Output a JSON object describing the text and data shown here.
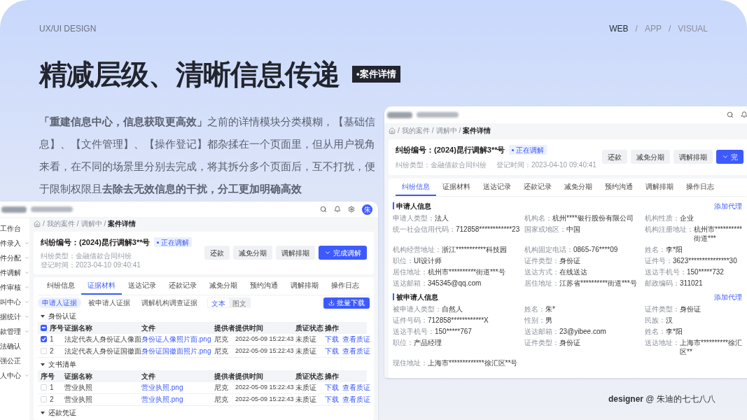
{
  "header": {
    "label": "UX/UI DESIGN",
    "nav": [
      {
        "kind": "link",
        "text": "WEB",
        "selected": true
      },
      {
        "kind": "separator",
        "text": "/"
      },
      {
        "kind": "link",
        "text": "APP",
        "selected": false
      },
      {
        "kind": "separator",
        "text": "/"
      },
      {
        "kind": "link",
        "text": "VISUAL",
        "selected": false
      }
    ]
  },
  "headline": {
    "title": "精减层级、清晰信息传递",
    "badge": "•案件详情"
  },
  "intro": "**「重建信息中心，信息获取更高效」**之前的详情模块分类模糊，【基础信息】、【文件管理】、【操作登记】都杂揉在一个页面里，但从用户视角来看，在不同的场景里分别去完成，将其拆分多个页面后，互不打扰，便于限制权限且**去除去无效信息的干扰，分工更加明确高效**",
  "evidence_screen": {
    "avatar": "朱",
    "sidebar": [
      {
        "label": "工作台",
        "expandable": false
      },
      {
        "label": "件录入",
        "expandable": true
      },
      {
        "label": "件分配",
        "expandable": true
      },
      {
        "label": "件调解",
        "expandable": true
      },
      {
        "label": "件审核",
        "expandable": true
      },
      {
        "label": "叫中心",
        "expandable": true
      },
      {
        "label": "据统计",
        "expandable": true
      },
      {
        "label": "款管理",
        "expandable": true
      },
      {
        "label": "法确认",
        "expandable": false
      },
      {
        "label": "强公正",
        "expandable": false
      },
      {
        "label": "人中心",
        "expandable": true
      }
    ],
    "breadcrumb": [
      {
        "kind": "separator",
        "text": "/"
      },
      {
        "kind": "crumb",
        "text": "我的案件",
        "current": false
      },
      {
        "kind": "separator",
        "text": "/"
      },
      {
        "kind": "crumb",
        "text": "调解中",
        "current": false
      },
      {
        "kind": "separator",
        "text": "/"
      },
      {
        "kind": "crumb",
        "text": "案件详情",
        "current": true
      }
    ],
    "case_title": "纠纷编号：(2024)昆行调解3**号",
    "status_tag": "正在调解",
    "meta": [
      "纠纷类型：金融借款合同纠纷",
      "登记时间：2023-04-10 09:40:41"
    ],
    "actions": [
      {
        "label": "还款",
        "kind": "secondary"
      },
      {
        "label": "减免分期",
        "kind": "secondary"
      },
      {
        "label": "调解排期",
        "kind": "secondary"
      },
      {
        "label": "完成调解",
        "kind": "primary"
      }
    ],
    "tabs": [
      {
        "label": "纠纷信息",
        "selected": false
      },
      {
        "label": "证据材料",
        "selected": true
      },
      {
        "label": "送达记录",
        "selected": false
      },
      {
        "label": "还款记录",
        "selected": false
      },
      {
        "label": "减免分期",
        "selected": false
      },
      {
        "label": "预约沟通",
        "selected": false
      },
      {
        "label": "调解排期",
        "selected": false
      },
      {
        "label": "操作日志",
        "selected": false
      }
    ],
    "evidence_tabs": [
      {
        "label": "申请人证据",
        "selected": true
      },
      {
        "label": "被申请人证据",
        "selected": false
      },
      {
        "label": "调解机构调查证据",
        "selected": false
      }
    ],
    "view_toggle": [
      {
        "label": "文本",
        "selected": true
      },
      {
        "label": "图文",
        "selected": false
      }
    ],
    "download_button": "批量下载",
    "groups": [
      {
        "title": "身份认证",
        "expanded": true,
        "header_indeterminate": true,
        "columns": [
          "序号",
          "证据名称",
          "文件",
          "提供者",
          "提供时间",
          "质证状态",
          "操作"
        ],
        "rows": [
          {
            "checked": true,
            "no": "1",
            "name": "法定代表人身份证人像面",
            "file": "身份证人像照片面.png",
            "provider": "尼克",
            "time": "2022-05-09 15:22:43",
            "status": "未质证",
            "links": [
              "下载",
              "查看质证"
            ]
          },
          {
            "checked": false,
            "no": "2",
            "name": "法定代表人身份证国徽面",
            "file": "身份证国徽面照片.png",
            "provider": "尼克",
            "time": "2022-05-09 15:22:43",
            "status": "未质证",
            "links": [
              "下载",
              "查看质证"
            ]
          }
        ]
      },
      {
        "title": "文书清单",
        "expanded": true,
        "columns": [
          "序号",
          "证据名称",
          "文件",
          "提供者",
          "提供时间",
          "质证状态",
          "操作"
        ],
        "rows": [
          {
            "checked": false,
            "no": "1",
            "name": "营业执照",
            "file": "营业执照.png",
            "provider": "尼克",
            "time": "2022-05-09 15:22:43",
            "status": "未质证",
            "links": [
              "下载",
              "查看质证"
            ]
          },
          {
            "checked": false,
            "no": "2",
            "name": "营业执照",
            "file": "营业执照.png",
            "provider": "尼克",
            "time": "2022-05-09 15:22:43",
            "status": "未质证",
            "links": [
              "下载",
              "查看质证"
            ]
          }
        ]
      },
      {
        "title": "还款凭证",
        "expanded": true
      }
    ]
  },
  "info_screen": {
    "breadcrumb": [
      {
        "kind": "separator",
        "text": "/"
      },
      {
        "kind": "crumb",
        "text": "我的案件",
        "current": false
      },
      {
        "kind": "separator",
        "text": "/"
      },
      {
        "kind": "crumb",
        "text": "调解中",
        "current": false
      },
      {
        "kind": "separator",
        "text": "/"
      },
      {
        "kind": "crumb",
        "text": "案件详情",
        "current": true
      }
    ],
    "case_title": "纠纷编号：(2024)昆行调解3**号",
    "status_tag": "正在调解",
    "meta": [
      "纠纷类型：金融借款合同纠纷",
      "登记时间：2023-04-10 09:40:41"
    ],
    "actions": [
      {
        "label": "还款",
        "kind": "secondary"
      },
      {
        "label": "减免分期",
        "kind": "secondary"
      },
      {
        "label": "调解排期",
        "kind": "secondary"
      },
      {
        "label": "完",
        "kind": "primary"
      }
    ],
    "tabs": [
      {
        "label": "纠纷信息",
        "selected": true
      },
      {
        "label": "证据材料",
        "selected": false
      },
      {
        "label": "送达记录",
        "selected": false
      },
      {
        "label": "还款记录",
        "selected": false
      },
      {
        "label": "减免分期",
        "selected": false
      },
      {
        "label": "预约沟通",
        "selected": false
      },
      {
        "label": "调解排期",
        "selected": false
      },
      {
        "label": "操作日志",
        "selected": false
      }
    ],
    "sections": [
      {
        "title": "申请人信息",
        "link": "添加代理",
        "fields": [
          {
            "label": "申请人类型：",
            "value": "法人"
          },
          {
            "label": "机构名：",
            "value": "杭州****银行股份有限公司"
          },
          {
            "label": "机构性质：",
            "value": "企业"
          },
          {
            "label": "统一社会信用代码：",
            "value": "712858************23"
          },
          {
            "label": "国家或地区：",
            "value": "中国"
          },
          {
            "label": "机构注册地址：",
            "value": "杭州市**********街道***"
          },
          {
            "label": "机构经营地址：",
            "value": "浙江***********科技园"
          },
          {
            "label": "机构固定电话：",
            "value": "0865-76****09"
          },
          {
            "label": "姓名：",
            "value": "李*阳"
          },
          {
            "label": "职位：",
            "value": "UI设计师"
          },
          {
            "label": "证件类型：",
            "value": "身份证"
          },
          {
            "label": "证件号：",
            "value": "3623***************30"
          },
          {
            "label": "居住地址：",
            "value": "杭州市**********街道***号"
          },
          {
            "label": "送达方式：",
            "value": "在线送达"
          },
          {
            "label": "送达手机号：",
            "value": "150*****732"
          },
          {
            "label": "送达邮箱：",
            "value": "345345@qq.com"
          },
          {
            "label": "居住地址：",
            "value": "江苏省**********街道***号"
          },
          {
            "label": "邮政编码：",
            "value": "311021"
          }
        ]
      },
      {
        "title": "被申请人信息",
        "link": "添加代理",
        "fields": [
          {
            "label": "被申请人类型：",
            "value": "自然人"
          },
          {
            "label": "姓名：",
            "value": "朱*"
          },
          {
            "label": "证件类型：",
            "value": "身份证"
          },
          {
            "label": "证件号码：",
            "value": "712858************X"
          },
          {
            "label": "性别：",
            "value": "男"
          },
          {
            "label": "民族：",
            "value": "汉"
          },
          {
            "label": "送达手机号：",
            "value": "150*****767"
          },
          {
            "label": "送达邮箱：",
            "value": "23@yibee.com"
          },
          {
            "label": "姓名：",
            "value": "李*阳"
          },
          {
            "label": "职位：",
            "value": "产品经理"
          },
          {
            "label": "证件类型：",
            "value": "身份证"
          },
          {
            "label": "送达地址：",
            "value": "上海市**********徐汇区**"
          },
          {
            "label": "现住地址：",
            "value": "上海市*************徐汇区**号"
          }
        ]
      }
    ]
  },
  "credit": "**designer** @ 朱迪的七七八八"
}
